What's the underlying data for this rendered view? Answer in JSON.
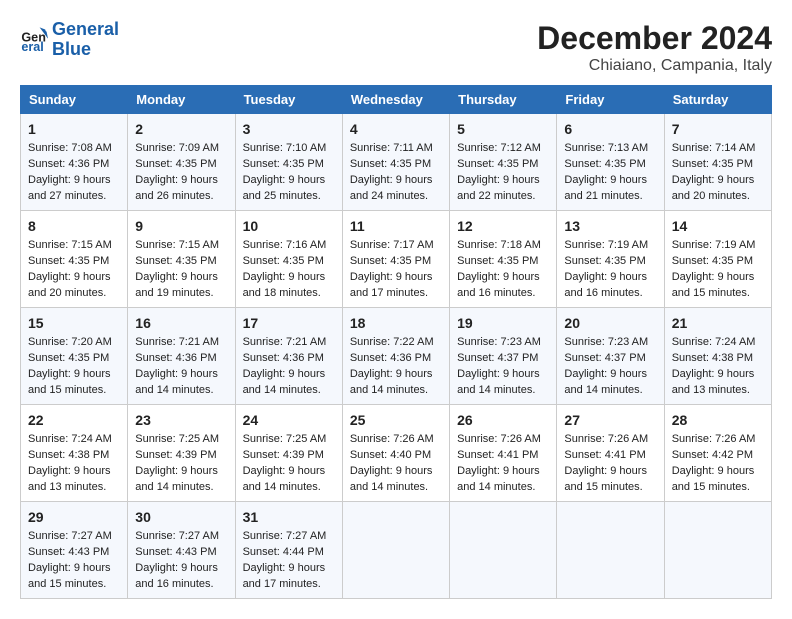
{
  "logo": {
    "line1": "General",
    "line2": "Blue"
  },
  "title": "December 2024",
  "subtitle": "Chiaiano, Campania, Italy",
  "days_of_week": [
    "Sunday",
    "Monday",
    "Tuesday",
    "Wednesday",
    "Thursday",
    "Friday",
    "Saturday"
  ],
  "weeks": [
    [
      {
        "day": 1,
        "lines": [
          "Sunrise: 7:08 AM",
          "Sunset: 4:36 PM",
          "Daylight: 9 hours",
          "and 27 minutes."
        ]
      },
      {
        "day": 2,
        "lines": [
          "Sunrise: 7:09 AM",
          "Sunset: 4:35 PM",
          "Daylight: 9 hours",
          "and 26 minutes."
        ]
      },
      {
        "day": 3,
        "lines": [
          "Sunrise: 7:10 AM",
          "Sunset: 4:35 PM",
          "Daylight: 9 hours",
          "and 25 minutes."
        ]
      },
      {
        "day": 4,
        "lines": [
          "Sunrise: 7:11 AM",
          "Sunset: 4:35 PM",
          "Daylight: 9 hours",
          "and 24 minutes."
        ]
      },
      {
        "day": 5,
        "lines": [
          "Sunrise: 7:12 AM",
          "Sunset: 4:35 PM",
          "Daylight: 9 hours",
          "and 22 minutes."
        ]
      },
      {
        "day": 6,
        "lines": [
          "Sunrise: 7:13 AM",
          "Sunset: 4:35 PM",
          "Daylight: 9 hours",
          "and 21 minutes."
        ]
      },
      {
        "day": 7,
        "lines": [
          "Sunrise: 7:14 AM",
          "Sunset: 4:35 PM",
          "Daylight: 9 hours",
          "and 20 minutes."
        ]
      }
    ],
    [
      {
        "day": 8,
        "lines": [
          "Sunrise: 7:15 AM",
          "Sunset: 4:35 PM",
          "Daylight: 9 hours",
          "and 20 minutes."
        ]
      },
      {
        "day": 9,
        "lines": [
          "Sunrise: 7:15 AM",
          "Sunset: 4:35 PM",
          "Daylight: 9 hours",
          "and 19 minutes."
        ]
      },
      {
        "day": 10,
        "lines": [
          "Sunrise: 7:16 AM",
          "Sunset: 4:35 PM",
          "Daylight: 9 hours",
          "and 18 minutes."
        ]
      },
      {
        "day": 11,
        "lines": [
          "Sunrise: 7:17 AM",
          "Sunset: 4:35 PM",
          "Daylight: 9 hours",
          "and 17 minutes."
        ]
      },
      {
        "day": 12,
        "lines": [
          "Sunrise: 7:18 AM",
          "Sunset: 4:35 PM",
          "Daylight: 9 hours",
          "and 16 minutes."
        ]
      },
      {
        "day": 13,
        "lines": [
          "Sunrise: 7:19 AM",
          "Sunset: 4:35 PM",
          "Daylight: 9 hours",
          "and 16 minutes."
        ]
      },
      {
        "day": 14,
        "lines": [
          "Sunrise: 7:19 AM",
          "Sunset: 4:35 PM",
          "Daylight: 9 hours",
          "and 15 minutes."
        ]
      }
    ],
    [
      {
        "day": 15,
        "lines": [
          "Sunrise: 7:20 AM",
          "Sunset: 4:35 PM",
          "Daylight: 9 hours",
          "and 15 minutes."
        ]
      },
      {
        "day": 16,
        "lines": [
          "Sunrise: 7:21 AM",
          "Sunset: 4:36 PM",
          "Daylight: 9 hours",
          "and 14 minutes."
        ]
      },
      {
        "day": 17,
        "lines": [
          "Sunrise: 7:21 AM",
          "Sunset: 4:36 PM",
          "Daylight: 9 hours",
          "and 14 minutes."
        ]
      },
      {
        "day": 18,
        "lines": [
          "Sunrise: 7:22 AM",
          "Sunset: 4:36 PM",
          "Daylight: 9 hours",
          "and 14 minutes."
        ]
      },
      {
        "day": 19,
        "lines": [
          "Sunrise: 7:23 AM",
          "Sunset: 4:37 PM",
          "Daylight: 9 hours",
          "and 14 minutes."
        ]
      },
      {
        "day": 20,
        "lines": [
          "Sunrise: 7:23 AM",
          "Sunset: 4:37 PM",
          "Daylight: 9 hours",
          "and 14 minutes."
        ]
      },
      {
        "day": 21,
        "lines": [
          "Sunrise: 7:24 AM",
          "Sunset: 4:38 PM",
          "Daylight: 9 hours",
          "and 13 minutes."
        ]
      }
    ],
    [
      {
        "day": 22,
        "lines": [
          "Sunrise: 7:24 AM",
          "Sunset: 4:38 PM",
          "Daylight: 9 hours",
          "and 13 minutes."
        ]
      },
      {
        "day": 23,
        "lines": [
          "Sunrise: 7:25 AM",
          "Sunset: 4:39 PM",
          "Daylight: 9 hours",
          "and 14 minutes."
        ]
      },
      {
        "day": 24,
        "lines": [
          "Sunrise: 7:25 AM",
          "Sunset: 4:39 PM",
          "Daylight: 9 hours",
          "and 14 minutes."
        ]
      },
      {
        "day": 25,
        "lines": [
          "Sunrise: 7:26 AM",
          "Sunset: 4:40 PM",
          "Daylight: 9 hours",
          "and 14 minutes."
        ]
      },
      {
        "day": 26,
        "lines": [
          "Sunrise: 7:26 AM",
          "Sunset: 4:41 PM",
          "Daylight: 9 hours",
          "and 14 minutes."
        ]
      },
      {
        "day": 27,
        "lines": [
          "Sunrise: 7:26 AM",
          "Sunset: 4:41 PM",
          "Daylight: 9 hours",
          "and 15 minutes."
        ]
      },
      {
        "day": 28,
        "lines": [
          "Sunrise: 7:26 AM",
          "Sunset: 4:42 PM",
          "Daylight: 9 hours",
          "and 15 minutes."
        ]
      }
    ],
    [
      {
        "day": 29,
        "lines": [
          "Sunrise: 7:27 AM",
          "Sunset: 4:43 PM",
          "Daylight: 9 hours",
          "and 15 minutes."
        ]
      },
      {
        "day": 30,
        "lines": [
          "Sunrise: 7:27 AM",
          "Sunset: 4:43 PM",
          "Daylight: 9 hours",
          "and 16 minutes."
        ]
      },
      {
        "day": 31,
        "lines": [
          "Sunrise: 7:27 AM",
          "Sunset: 4:44 PM",
          "Daylight: 9 hours",
          "and 17 minutes."
        ]
      },
      null,
      null,
      null,
      null
    ]
  ]
}
